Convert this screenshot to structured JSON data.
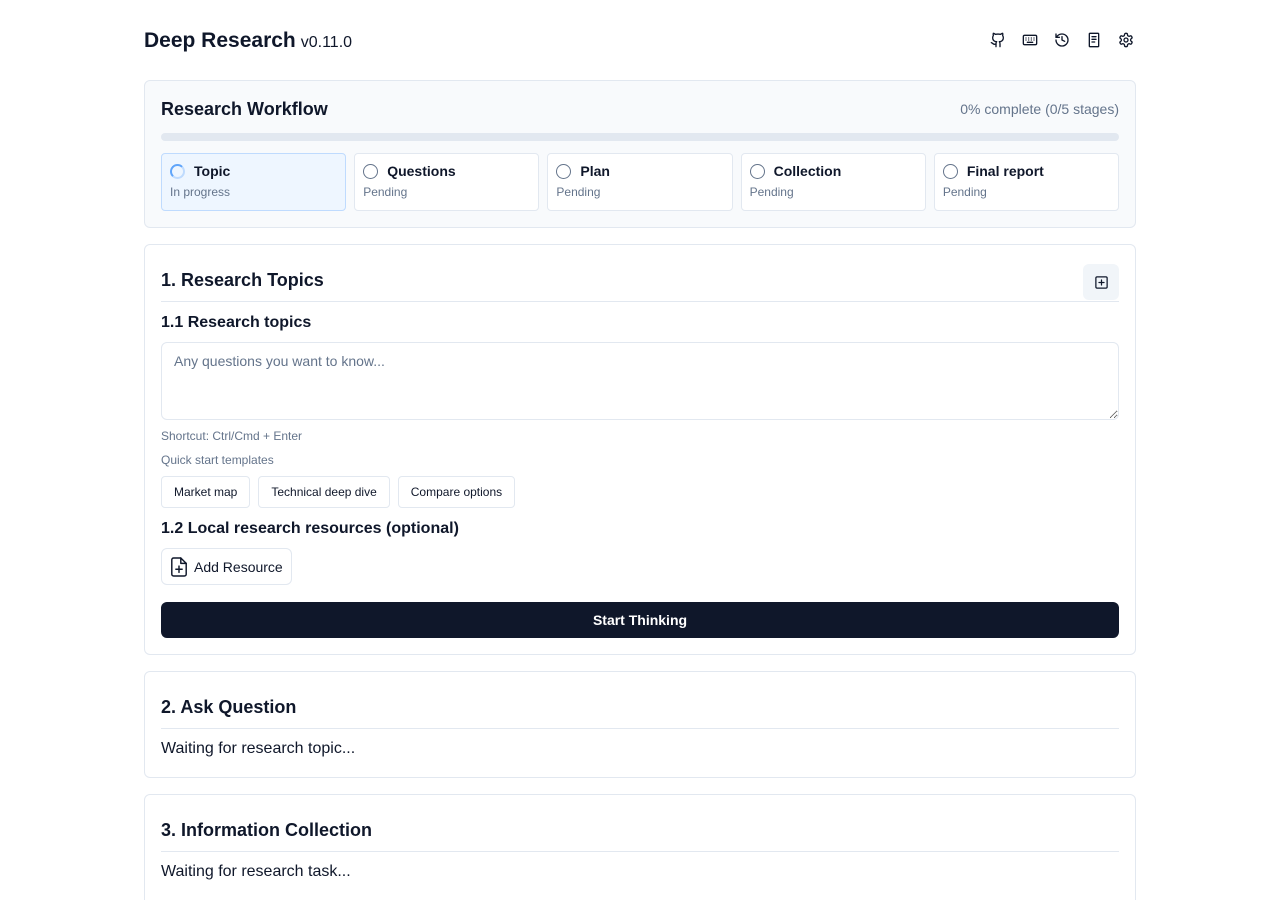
{
  "header": {
    "title": "Deep Research",
    "version": "v0.11.0",
    "icons": [
      "github-icon",
      "keyboard-icon",
      "history-icon",
      "knowledge-icon",
      "settings-icon"
    ]
  },
  "workflow": {
    "title": "Research Workflow",
    "progress_text": "0% complete (0/5 stages)",
    "progress": 0,
    "stages": [
      {
        "label": "Topic",
        "status": "In progress"
      },
      {
        "label": "Questions",
        "status": "Pending"
      },
      {
        "label": "Plan",
        "status": "Pending"
      },
      {
        "label": "Collection",
        "status": "Pending"
      },
      {
        "label": "Final report",
        "status": "Pending"
      }
    ]
  },
  "topics": {
    "title": "1. Research Topics",
    "sub1": "1.1 Research topics",
    "placeholder": "Any questions you want to know...",
    "shortcut": "Shortcut: Ctrl/Cmd + Enter",
    "templates_label": "Quick start templates",
    "templates": [
      "Market map",
      "Technical deep dive",
      "Compare options"
    ],
    "sub2": "1.2 Local research resources (optional)",
    "add_resource": "Add Resource",
    "start": "Start Thinking"
  },
  "ask": {
    "title": "2. Ask Question",
    "waiting": "Waiting for research topic..."
  },
  "collection": {
    "title": "3. Information Collection",
    "waiting": "Waiting for research task..."
  },
  "colors": {
    "primary": "#0f172a",
    "border": "#e2e8f0",
    "muted": "#64748b",
    "active_stage_bg": "#eef6ff",
    "spinner": "#60a5fa"
  }
}
